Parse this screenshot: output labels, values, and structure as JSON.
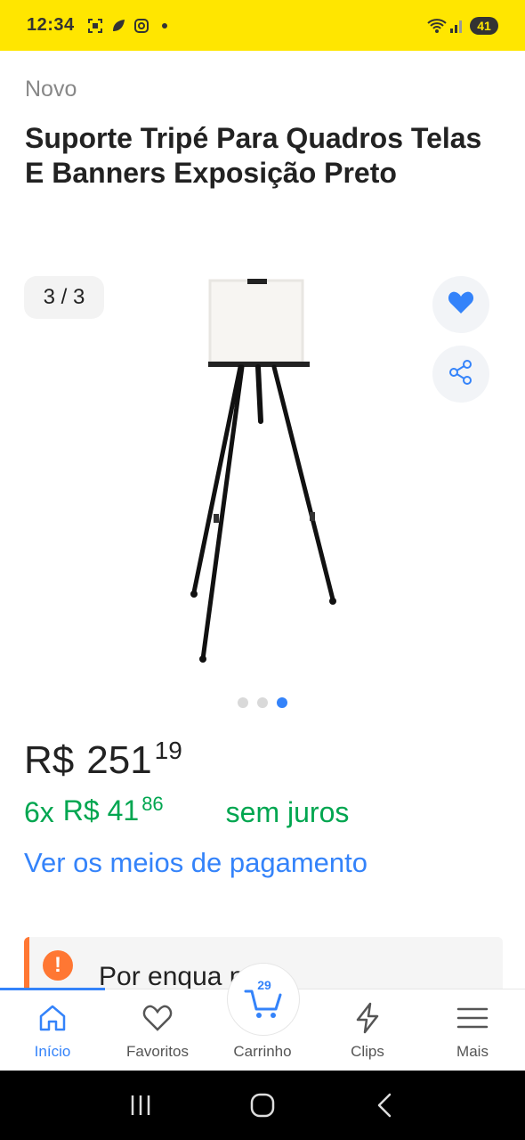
{
  "status_bar": {
    "time": "12:34",
    "battery": "41",
    "icons_left": [
      "screenshot-icon",
      "leaf-icon",
      "instagram-icon",
      "dot-icon"
    ],
    "icons_right": [
      "wifi-icon",
      "signal-icon",
      "battery-icon"
    ]
  },
  "product": {
    "condition": "Novo",
    "title": "Suporte Tripé Para Quadros Telas E Banners Exposição Preto"
  },
  "gallery": {
    "counter": "3 / 3",
    "total_images": 3,
    "active_index": 3
  },
  "price": {
    "currency": "R$",
    "integer": "251",
    "cents": "19"
  },
  "installments": {
    "count": "6x",
    "amount_integer": "R$ 41",
    "amount_cents": "86",
    "interest": "sem juros"
  },
  "payment_link": "Ver os meios de pagamento",
  "notice": {
    "icon": "!",
    "text_visible": "Por enqua      não"
  },
  "bottom_nav": {
    "items": [
      {
        "label": "Início",
        "icon": "home-icon",
        "active": true
      },
      {
        "label": "Favoritos",
        "icon": "heart-icon",
        "active": false
      },
      {
        "label": "Carrinho",
        "icon": "cart-icon",
        "active": false,
        "badge": "29"
      },
      {
        "label": "Clips",
        "icon": "lightning-icon",
        "active": false
      },
      {
        "label": "Mais",
        "icon": "menu-icon",
        "active": false
      }
    ]
  },
  "colors": {
    "brand_yellow": "#ffe600",
    "link_blue": "#3483fa",
    "price_green": "#00a650",
    "warning_orange": "#ff7733"
  }
}
